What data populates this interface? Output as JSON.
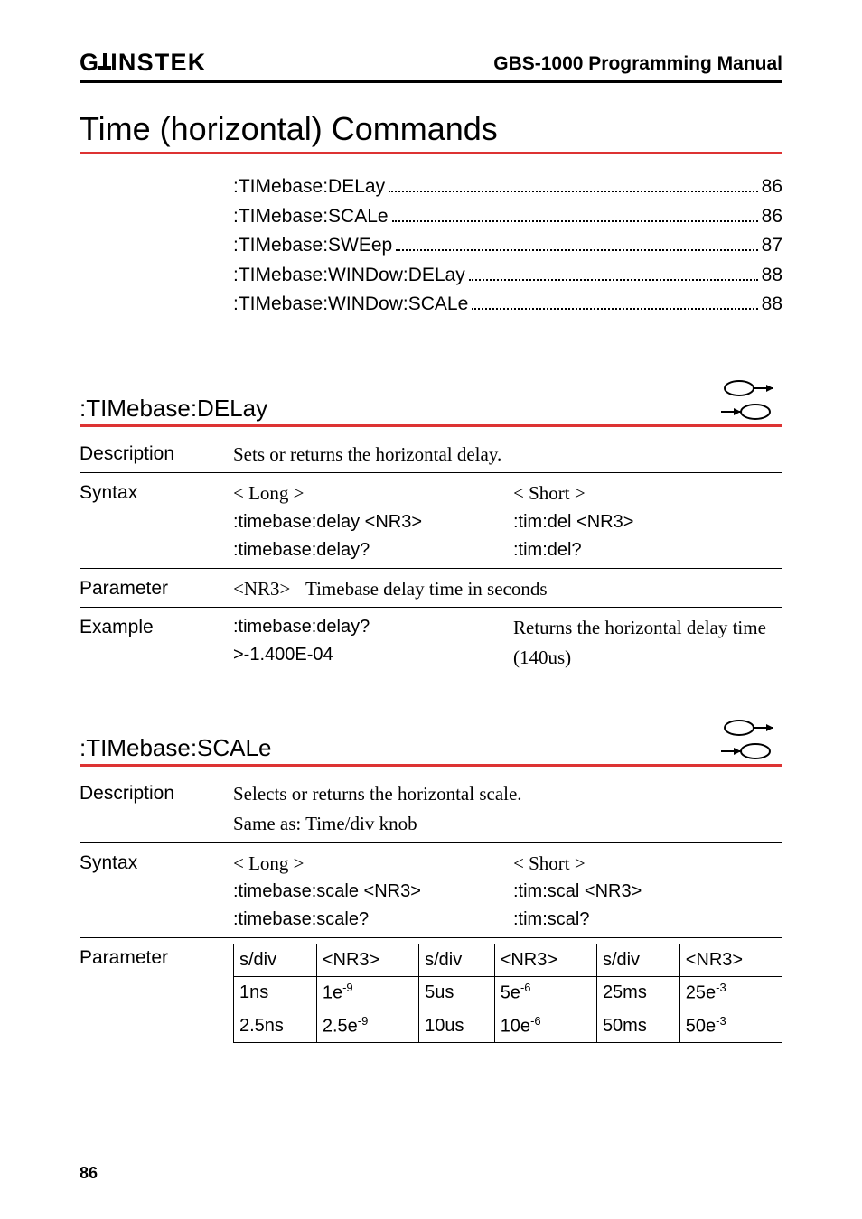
{
  "header": {
    "brand_pre": "G",
    "brand_post": "INSTEK",
    "title": "GBS-1000 Programming Manual"
  },
  "section_title": "Time (horizontal) Commands",
  "toc": [
    {
      "label": ":TIMebase:DELay",
      "page": "86"
    },
    {
      "label": ":TIMebase:SCALe",
      "page": "86"
    },
    {
      "label": ":TIMebase:SWEep",
      "page": "87"
    },
    {
      "label": ":TIMebase:WINDow:DELay",
      "page": "88"
    },
    {
      "label": ":TIMebase:WINDow:SCALe",
      "page": "88"
    }
  ],
  "labels": {
    "description": "Description",
    "syntax": "Syntax",
    "parameter": "Parameter",
    "example": "Example",
    "long": "< Long >",
    "short": "< Short >"
  },
  "delay": {
    "heading": ":TIMebase:DELay",
    "description": "Sets or returns the horizontal delay.",
    "syntax_long_set": ":timebase:delay <NR3>",
    "syntax_long_query": ":timebase:delay?",
    "syntax_short_set": ":tim:del <NR3>",
    "syntax_short_query": ":tim:del?",
    "param_tag": "<NR3>",
    "param_desc": "Timebase delay time in seconds",
    "example_cmd1": ":timebase:delay?",
    "example_cmd2": ">-1.400E-04",
    "example_result": "Returns the horizontal delay time (140us)"
  },
  "scale": {
    "heading": ":TIMebase:SCALe",
    "description1": "Selects or returns the horizontal scale.",
    "description2": "Same as: Time/div knob",
    "syntax_long_set": ":timebase:scale <NR3>",
    "syntax_long_query": ":timebase:scale?",
    "syntax_short_set": ":tim:scal <NR3>",
    "syntax_short_query": ":tim:scal?",
    "param_headers": [
      "s/div",
      "<NR3>",
      "s/div",
      "<NR3>",
      "s/div",
      "<NR3>"
    ],
    "param_rows": [
      [
        "1ns",
        "1e",
        "-9",
        "5us",
        "5e",
        "-6",
        "25ms",
        "25e",
        "-3"
      ],
      [
        "2.5ns",
        "2.5e",
        "-9",
        "10us",
        "10e",
        "-6",
        "50ms",
        "50e",
        "-3"
      ]
    ]
  },
  "chart_data": {
    "type": "table",
    "title": "TIMebase:SCALe parameter values",
    "columns": [
      "s/div",
      "<NR3>",
      "s/div",
      "<NR3>",
      "s/div",
      "<NR3>"
    ],
    "rows": [
      [
        "1ns",
        "1e-9",
        "5us",
        "5e-6",
        "25ms",
        "25e-3"
      ],
      [
        "2.5ns",
        "2.5e-9",
        "10us",
        "10e-6",
        "50ms",
        "50e-3"
      ]
    ]
  },
  "page_number": "86"
}
